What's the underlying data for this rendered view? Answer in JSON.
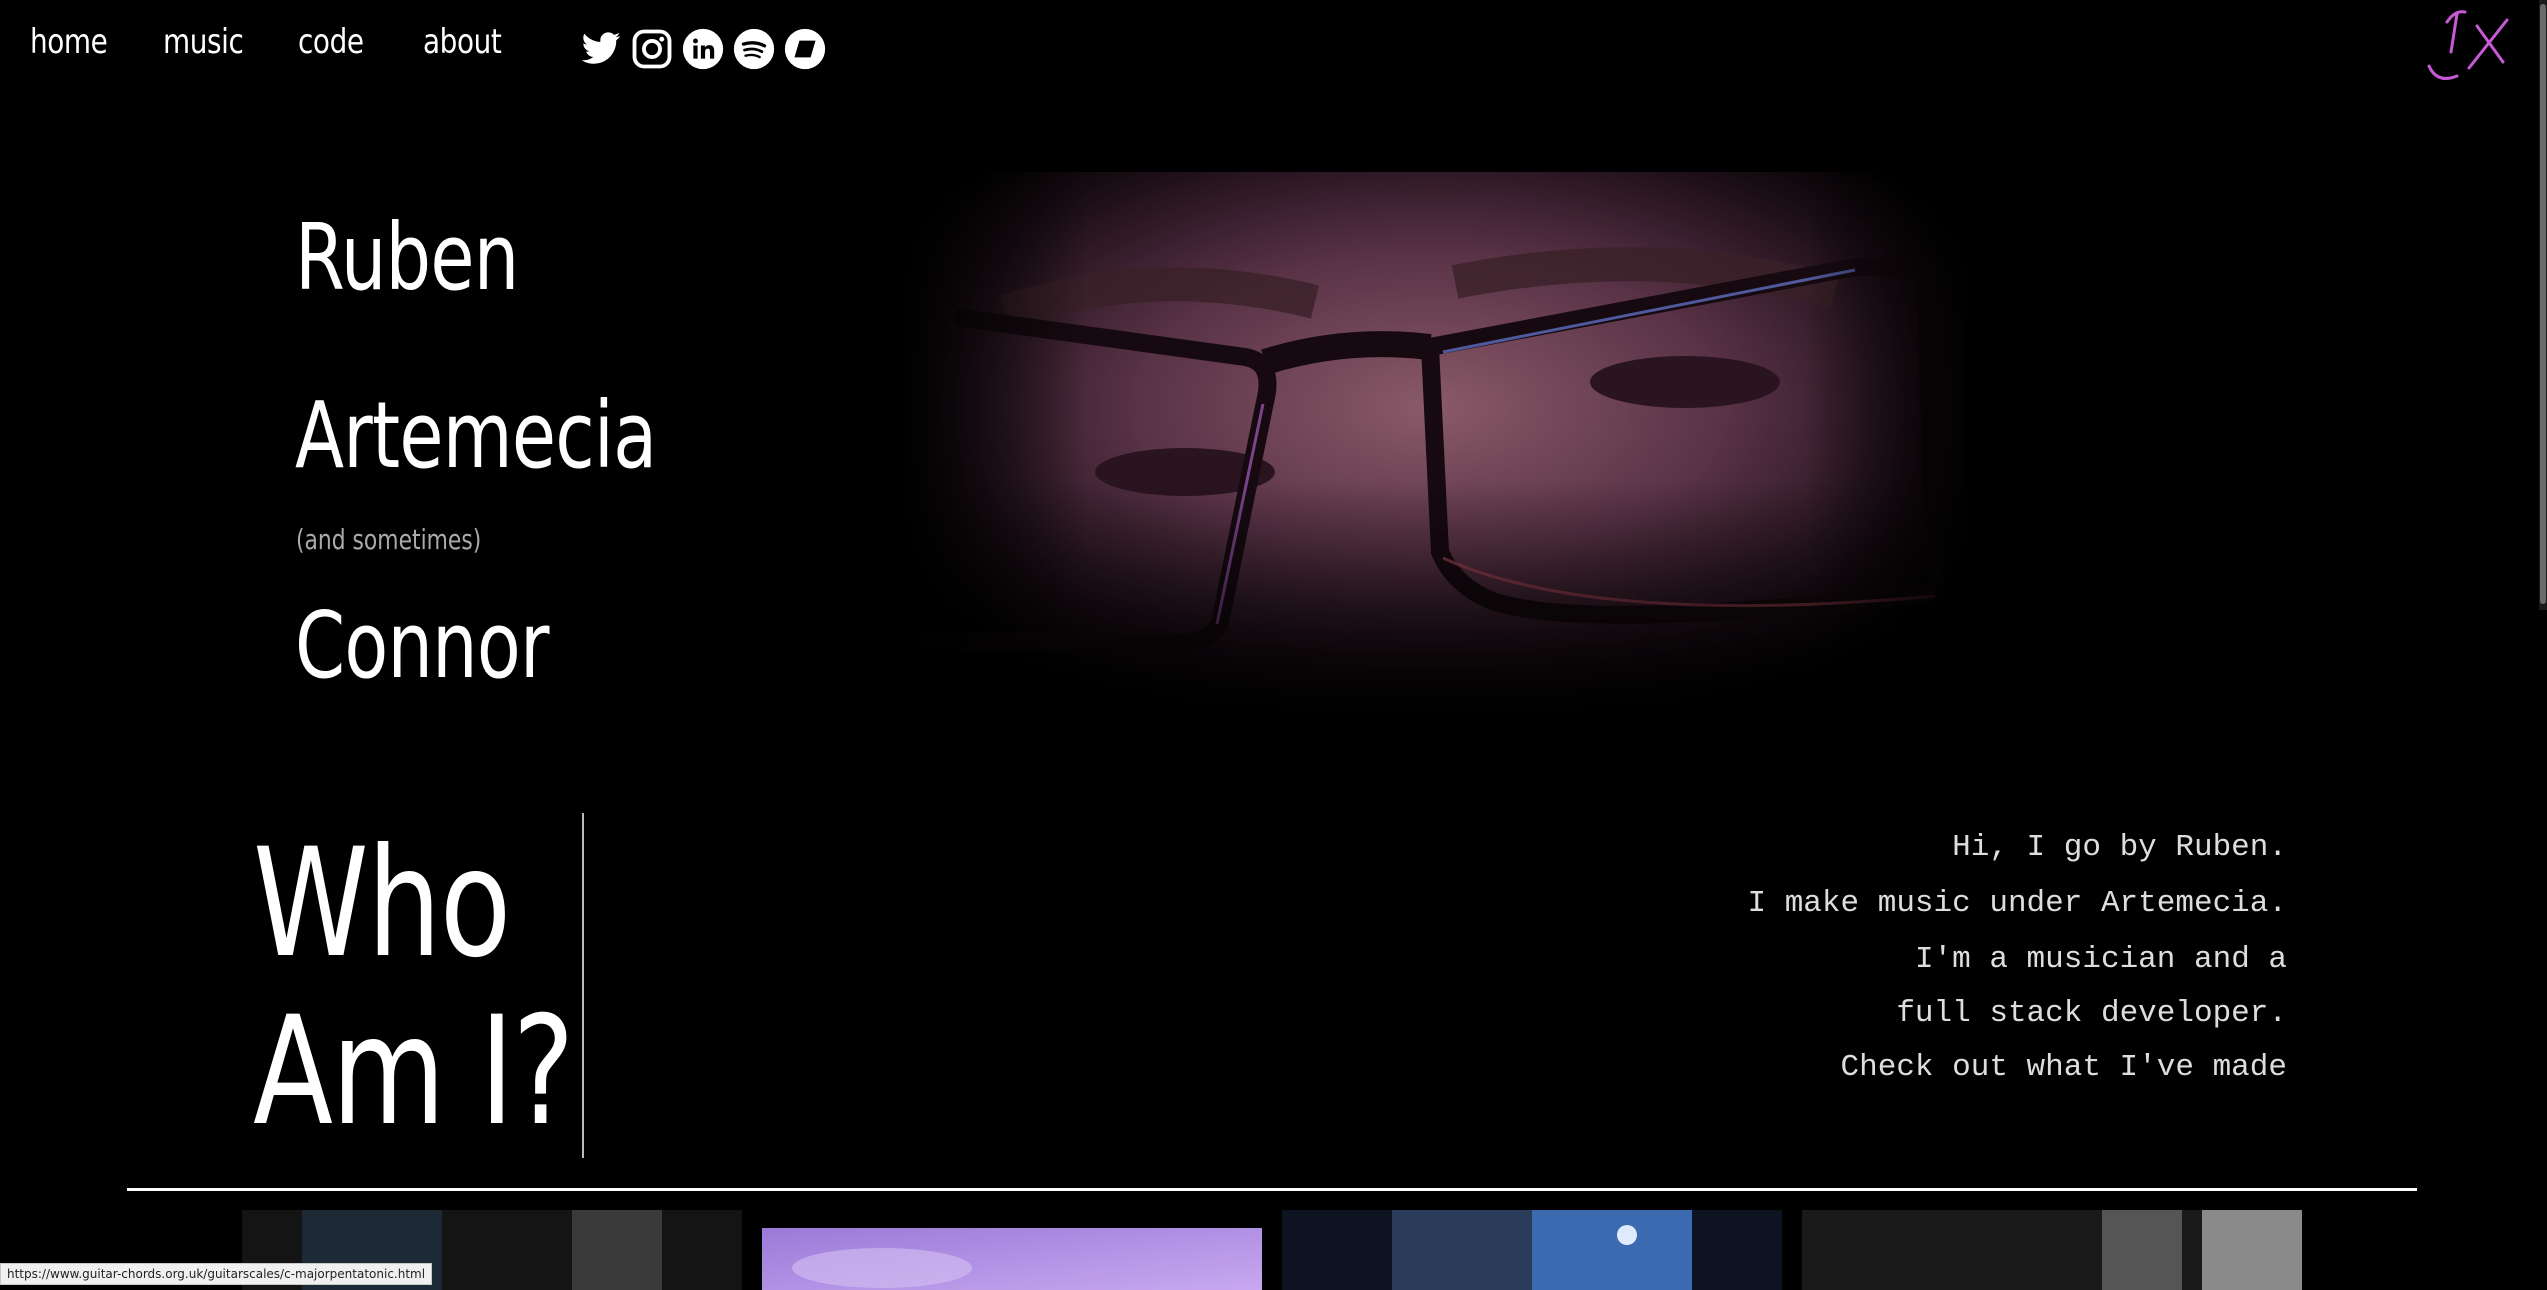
{
  "nav": {
    "items": [
      {
        "label": "home"
      },
      {
        "label": "music"
      },
      {
        "label": "code"
      },
      {
        "label": "about"
      }
    ],
    "social": [
      "twitter-icon",
      "instagram-icon",
      "linkedin-icon",
      "spotify-icon",
      "bandcamp-icon"
    ]
  },
  "hero": {
    "first": "Ruben",
    "second": "Artemecia",
    "aside": "(and sometimes)",
    "third": "Connor"
  },
  "who": {
    "line1": "Who",
    "line2": "Am I?"
  },
  "intro": [
    "Hi, I go by Ruben.",
    "I make music under Artemecia.",
    "I'm a musician and a",
    "full stack developer.",
    "Check out what I've made"
  ],
  "statusbar": {
    "url": "https://www.guitar-chords.org.uk/guitarscales/c-majorpentatonic.html"
  },
  "colors": {
    "signature": "#c85ad8",
    "background": "#000000",
    "text": "#ffffff"
  }
}
